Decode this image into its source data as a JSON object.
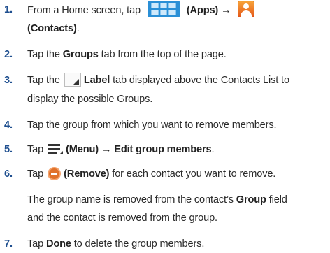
{
  "steps": [
    {
      "num": "1.",
      "l1_before": "From a Home screen, tap",
      "l1_apps": "(Apps)",
      "l1_arrow": "→",
      "l2_contacts": "(Contacts)",
      "l2_after": "."
    },
    {
      "num": "2.",
      "t1": "Tap the ",
      "b1": "Groups",
      "t2": " tab from the top of the page."
    },
    {
      "num": "3.",
      "t1": "Tap the",
      "b1": "Label",
      "t2": " tab displayed above the Contacts List to",
      "l2": "display the possible Groups."
    },
    {
      "num": "4.",
      "t1": "Tap the group from which you want to remove members."
    },
    {
      "num": "5.",
      "t1": "Tap",
      "b1": "(Menu)",
      "arrow": "→",
      "b2": "Edit group members",
      "t2": "."
    },
    {
      "num": "6.",
      "t1": "Tap",
      "b1": "(Remove)",
      "t2": " for each contact you want to remove."
    },
    {
      "num": "7.",
      "t1": "Tap ",
      "b1": "Done",
      "t2": " to delete the group members."
    }
  ],
  "note": {
    "l1_t1": "The group name is removed from the contact’s ",
    "l1_b1": "Group",
    "l1_t2": " field",
    "l2": "and the contact is removed from the group."
  },
  "icons": [
    "apps-grid-icon",
    "contacts-icon",
    "label-tab-icon",
    "menu-icon",
    "remove-icon"
  ],
  "colors": {
    "step_number": "#1f4f8f",
    "apps_icon": "#2a8fd6",
    "contacts_icon": "#e5591a",
    "remove_icon": "#e0712a"
  }
}
